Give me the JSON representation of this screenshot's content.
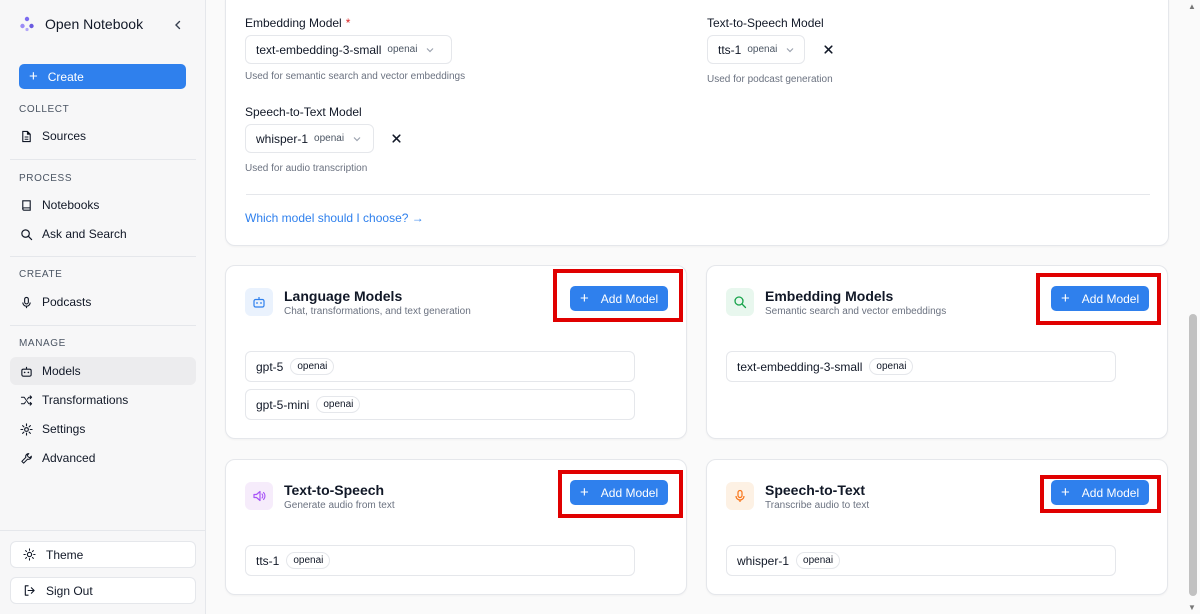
{
  "app": {
    "name": "Open Notebook"
  },
  "sidebar": {
    "create_label": "Create",
    "sections": {
      "collect": "COLLECT",
      "process": "PROCESS",
      "create": "CREATE",
      "manage": "MANAGE"
    },
    "items": {
      "sources": "Sources",
      "notebooks": "Notebooks",
      "ask_search": "Ask and Search",
      "podcasts": "Podcasts",
      "models": "Models",
      "transformations": "Transformations",
      "settings": "Settings",
      "advanced": "Advanced"
    },
    "active": "models",
    "theme_label": "Theme",
    "signout_label": "Sign Out"
  },
  "defaults": {
    "embedding": {
      "label": "Embedding Model",
      "required_mark": "*",
      "value": "text-embedding-3-small",
      "provider": "openai",
      "help": "Used for semantic search and vector embeddings"
    },
    "tts": {
      "label": "Text-to-Speech Model",
      "value": "tts-1",
      "provider": "openai",
      "help": "Used for podcast generation"
    },
    "stt": {
      "label": "Speech-to-Text Model",
      "value": "whisper-1",
      "provider": "openai",
      "help": "Used for audio transcription"
    },
    "guide_link": "Which model should I choose? →"
  },
  "cards": {
    "language": {
      "title": "Language Models",
      "subtitle": "Chat, transformations, and text generation",
      "button": "Add Model",
      "models": [
        {
          "name": "gpt-5",
          "provider": "openai"
        },
        {
          "name": "gpt-5-mini",
          "provider": "openai"
        }
      ]
    },
    "embedding": {
      "title": "Embedding Models",
      "subtitle": "Semantic search and vector embeddings",
      "button": "Add Model",
      "models": [
        {
          "name": "text-embedding-3-small",
          "provider": "openai"
        }
      ]
    },
    "tts": {
      "title": "Text-to-Speech",
      "subtitle": "Generate audio from text",
      "button": "Add Model",
      "models": [
        {
          "name": "tts-1",
          "provider": "openai"
        }
      ]
    },
    "stt": {
      "title": "Speech-to-Text",
      "subtitle": "Transcribe audio to text",
      "button": "Add Model",
      "models": [
        {
          "name": "whisper-1",
          "provider": "openai"
        }
      ]
    }
  },
  "colors": {
    "accent": "#2f80ed",
    "highlight": "#e00000",
    "language_icon_bg": "#eaf2fd",
    "embedding_icon_bg": "#e8f7ee",
    "tts_icon_bg": "#f6ecfb",
    "stt_icon_bg": "#fdf1e4"
  }
}
